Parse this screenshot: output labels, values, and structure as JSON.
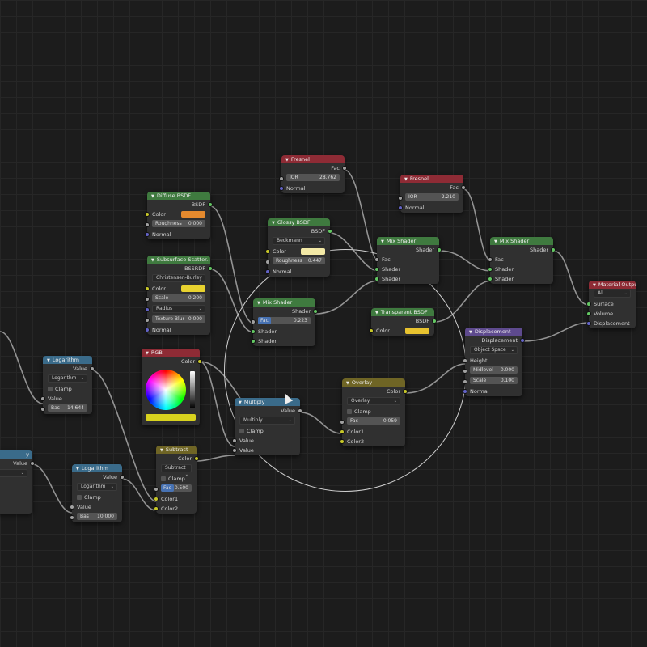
{
  "nodes": {
    "fresnel1": {
      "title": "Fresnel",
      "out_fac": "Fac",
      "ior_label": "IOR",
      "ior_value": "28.762",
      "normal": "Normal"
    },
    "fresnel2": {
      "title": "Fresnel",
      "out_fac": "Fac",
      "ior_label": "IOR",
      "ior_value": "2.210",
      "normal": "Normal"
    },
    "diffuse": {
      "title": "Diffuse BSDF",
      "out": "BSDF",
      "color": "Color",
      "rough_label": "Roughness",
      "rough_value": "0.000",
      "normal": "Normal",
      "swatch": "#e58a2e"
    },
    "glossy": {
      "title": "Glossy BSDF",
      "out": "BSDF",
      "dist": "Beckmann",
      "color": "Color",
      "rough_label": "Roughness",
      "rough_value": "0.447",
      "normal": "Normal",
      "swatch": "#f3e9a6"
    },
    "sss": {
      "title": "Subsurface Scatter...",
      "out": "BSSRDF",
      "method": "Christensen-Burley",
      "color": "Color",
      "scale_label": "Scale",
      "scale_value": "0.200",
      "radius": "Radius",
      "blur_label": "Texture Blur",
      "blur_value": "0.000",
      "normal": "Normal",
      "swatch": "#e8d22f"
    },
    "mix1": {
      "title": "Mix Shader",
      "out": "Shader",
      "fac": "Fac",
      "shader1": "Shader",
      "shader2": "Shader"
    },
    "mix2": {
      "title": "Mix Shader",
      "out": "Shader",
      "fac": "Fac",
      "shader1": "Shader",
      "shader2": "Shader"
    },
    "mix3": {
      "title": "Mix Shader",
      "out": "Shader",
      "fac_label": "Fac",
      "fac_value": "0.223",
      "shader1": "Shader",
      "shader2": "Shader"
    },
    "transparent": {
      "title": "Transparent BSDF",
      "out": "BSDF",
      "color": "Color",
      "swatch": "#e8c32f"
    },
    "output": {
      "title": "Material Output",
      "target": "All",
      "surface": "Surface",
      "volume": "Volume",
      "displacement": "Displacement"
    },
    "displacement": {
      "title": "Displacement",
      "out": "Displacement",
      "space": "Object Space",
      "height": "Height",
      "mid_label": "Midlevel",
      "mid_value": "0.000",
      "scale_label": "Scale",
      "scale_value": "0.100",
      "normal": "Normal"
    },
    "rgb": {
      "title": "RGB",
      "out": "Color",
      "swatch": "#d8d21e"
    },
    "multiply": {
      "title": "Multiply",
      "out": "Value",
      "op": "Multiply",
      "clamp": "Clamp",
      "v1": "Value",
      "v2": "Value"
    },
    "overlay": {
      "title": "Overlay",
      "out": "Color",
      "op": "Overlay",
      "clamp": "Clamp",
      "fac_label": "Fac",
      "fac_value": "0.059",
      "c1": "Color1",
      "c2": "Color2"
    },
    "subtract": {
      "title": "Subtract",
      "out": "Color",
      "op": "Subtract",
      "clamp": "Clamp",
      "fac_label": "Fac",
      "fac_value": "0.500",
      "c1": "Color1",
      "c2": "Color2"
    },
    "log1": {
      "title": "Logarithm",
      "out": "Value",
      "op": "Logarithm",
      "clamp": "Clamp",
      "value": "Value",
      "base_label": "Bas",
      "base_value": "14.644"
    },
    "log2": {
      "title": "Logarithm",
      "out": "Value",
      "op": "Logarithm",
      "clamp": "Clamp",
      "value": "Value",
      "base_label": "Bas",
      "base_value": "10.000"
    },
    "partial": {
      "title": "y",
      "out": "Value"
    }
  }
}
